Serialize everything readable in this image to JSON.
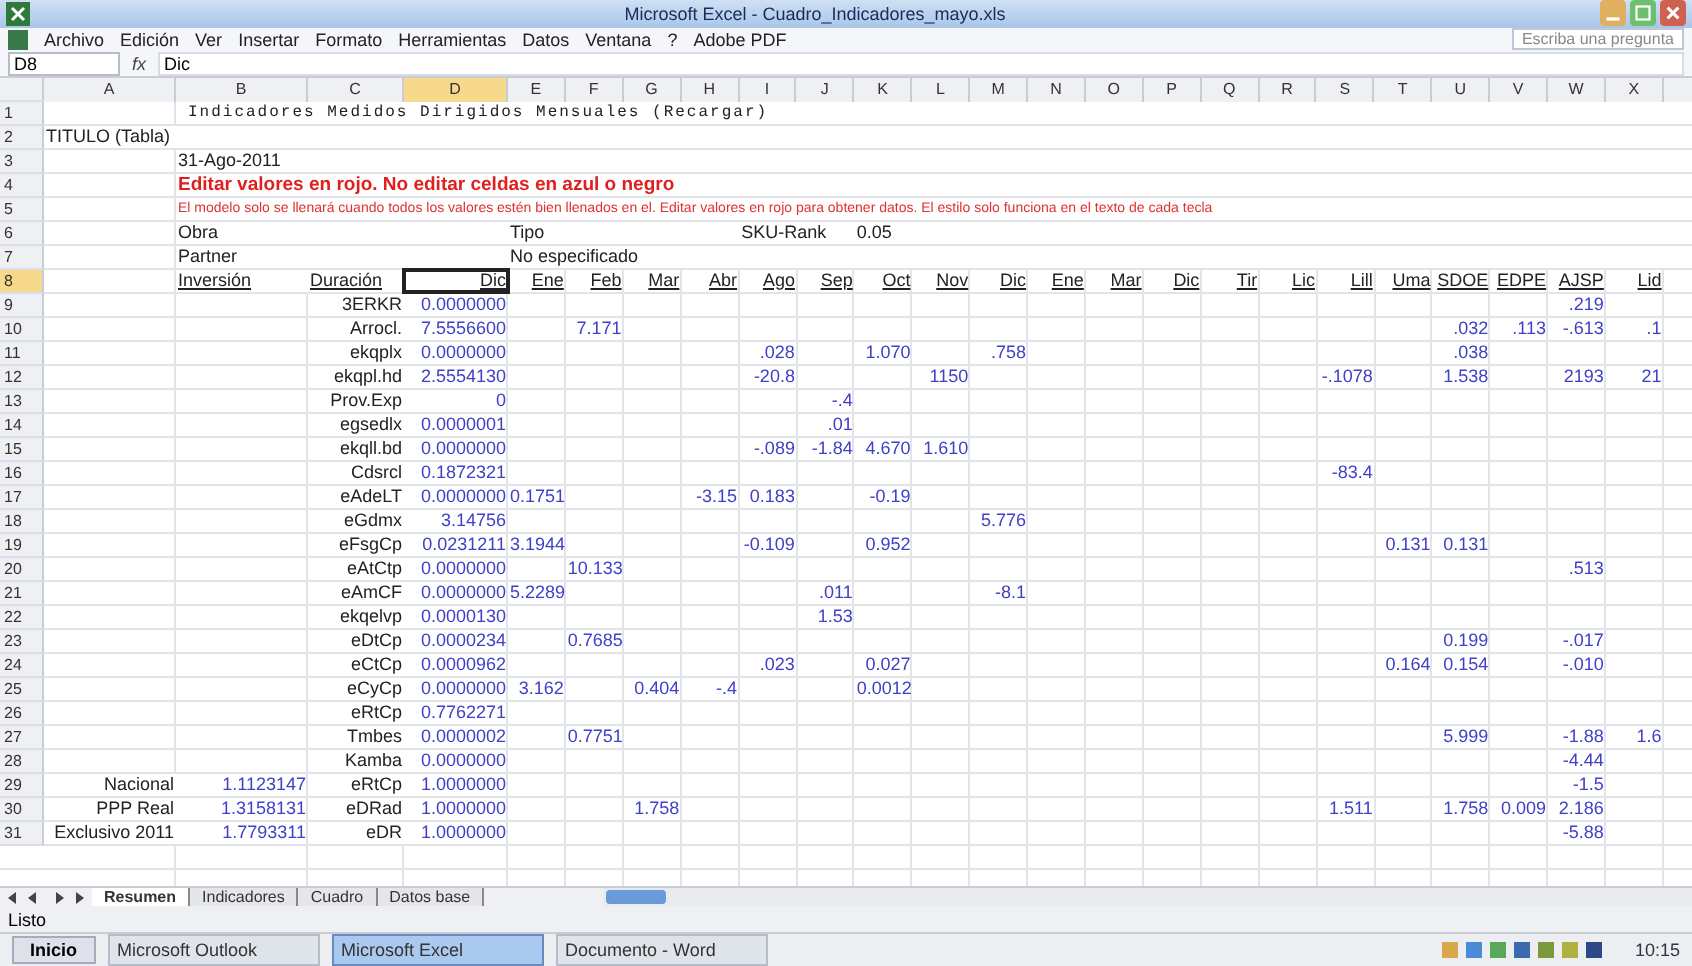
{
  "window": {
    "title": "Microsoft Excel - Cuadro_Indicadores_mayo.xls"
  },
  "menu": [
    "Archivo",
    "Edición",
    "Ver",
    "Insertar",
    "Formato",
    "Herramientas",
    "Datos",
    "Ventana",
    "?",
    "Adobe PDF"
  ],
  "help_box": {
    "placeholder": "Escriba una pregunta"
  },
  "name_box": "D8",
  "formula_label": "fx",
  "formula": "Dic",
  "columns": [
    "A",
    "B",
    "C",
    "D",
    "E",
    "F",
    "G",
    "H",
    "I",
    "J",
    "K",
    "L",
    "M",
    "N",
    "O",
    "P",
    "Q",
    "R",
    "S",
    "T",
    "U",
    "V",
    "W",
    "X"
  ],
  "rows": [
    {
      "num": "1",
      "kind": "title",
      "cells": {
        "B": {
          "kind": "label",
          "text": "Indicadores Medidos Dirigidos Mensuales (Recargar)"
        }
      }
    },
    {
      "num": "2",
      "kind": "plain",
      "cells": {
        "A": {
          "kind": "label",
          "text": "TITULO (Tabla)"
        }
      }
    },
    {
      "num": "3",
      "kind": "plain",
      "cells": {
        "B": {
          "kind": "label",
          "text": "31-Ago-2011"
        }
      }
    },
    {
      "num": "4",
      "kind": "warning",
      "cells": {
        "B": {
          "kind": "label",
          "text": "Editar valores en rojo. No editar celdas en azul o negro"
        }
      }
    },
    {
      "num": "5",
      "kind": "notice",
      "cells": {
        "B": {
          "kind": "label",
          "text": "El modelo solo se llenará cuando todos los valores estén bien llenados en el. Editar valores en rojo para obtener datos. El estilo solo funciona en el texto de cada tecla"
        }
      }
    },
    {
      "num": "6",
      "kind": "plain",
      "cells": {
        "B": {
          "kind": "label",
          "text": "Obra"
        },
        "E": {
          "kind": "label",
          "text": "Tipo"
        },
        "I": {
          "kind": "label",
          "text": "SKU-Rank"
        },
        "K": {
          "kind": "label",
          "text": "0.05"
        }
      }
    },
    {
      "num": "7",
      "kind": "plain",
      "cells": {
        "B": {
          "kind": "label",
          "text": "Partner"
        },
        "E": {
          "kind": "label",
          "text": "No especificado"
        }
      }
    },
    {
      "num": "8",
      "kind": "header",
      "cells": {
        "B": {
          "kind": "label",
          "text": "Inversión"
        },
        "C": {
          "kind": "label",
          "text": "Duración"
        },
        "D": {
          "kind": "head",
          "text": "Dic"
        },
        "E": {
          "kind": "head",
          "text": "Ene"
        },
        "F": {
          "kind": "head",
          "text": "Feb"
        },
        "G": {
          "kind": "head",
          "text": "Mar"
        },
        "H": {
          "kind": "head",
          "text": "Abr"
        },
        "I": {
          "kind": "head",
          "text": "Ago"
        },
        "J": {
          "kind": "head",
          "text": "Sep"
        },
        "K": {
          "kind": "head",
          "text": "Oct"
        },
        "L": {
          "kind": "head",
          "text": "Nov"
        },
        "M": {
          "kind": "head",
          "text": "Dic"
        },
        "N": {
          "kind": "head",
          "text": "Ene"
        },
        "O": {
          "kind": "head",
          "text": "Mar"
        },
        "P": {
          "kind": "head",
          "text": "Dic"
        },
        "Q": {
          "kind": "head",
          "text": "Tir"
        },
        "R": {
          "kind": "head",
          "text": "Lic"
        },
        "S": {
          "kind": "head",
          "text": "Lill"
        },
        "T": {
          "kind": "head",
          "text": "Uma"
        },
        "U": {
          "kind": "head",
          "text": "SDOE"
        },
        "V": {
          "kind": "head",
          "text": "EDPE"
        },
        "W": {
          "kind": "head",
          "text": "AJSP"
        },
        "X": {
          "kind": "head",
          "text": "Lid"
        }
      }
    },
    {
      "num": "9",
      "kind": "data",
      "cells": {
        "C": {
          "kind": "label",
          "text": "3ERKR"
        },
        "D": {
          "kind": "input",
          "text": "0.0000000"
        },
        "W": {
          "kind": "input",
          "text": ".219"
        }
      }
    },
    {
      "num": "10",
      "kind": "data",
      "cells": {
        "C": {
          "kind": "label",
          "text": "Arrocl."
        },
        "D": {
          "kind": "input",
          "text": "7.5556600"
        },
        "F": {
          "kind": "input",
          "text": "7.171"
        },
        "U": {
          "kind": "input",
          "text": ".032"
        },
        "V": {
          "kind": "input",
          "text": ".113"
        },
        "W": {
          "kind": "input",
          "text": "-.613"
        },
        "X": {
          "kind": "input",
          "text": ".1"
        }
      }
    },
    {
      "num": "11",
      "kind": "data",
      "cells": {
        "C": {
          "kind": "label",
          "text": "ekqplx"
        },
        "D": {
          "kind": "input",
          "text": "0.0000000"
        },
        "I": {
          "kind": "input",
          "text": ".028"
        },
        "K": {
          "kind": "input",
          "text": "1.070"
        },
        "M": {
          "kind": "input",
          "text": ".758"
        },
        "U": {
          "kind": "input",
          "text": ".038"
        }
      }
    },
    {
      "num": "12",
      "kind": "data",
      "cells": {
        "C": {
          "kind": "label",
          "text": "ekqpl.hd"
        },
        "D": {
          "kind": "input",
          "text": "2.5554130"
        },
        "I": {
          "kind": "input",
          "text": "-20.8"
        },
        "L": {
          "kind": "input",
          "text": "1150"
        },
        "S": {
          "kind": "input",
          "text": "-.1078"
        },
        "U": {
          "kind": "input",
          "text": "1.538"
        },
        "W": {
          "kind": "input",
          "text": "2193"
        },
        "X": {
          "kind": "input",
          "text": "21"
        }
      }
    },
    {
      "num": "13",
      "kind": "data",
      "cells": {
        "C": {
          "kind": "label",
          "text": "Prov.Exp"
        },
        "D": {
          "kind": "input",
          "text": "0"
        },
        "J": {
          "kind": "input",
          "text": "-.4"
        }
      }
    },
    {
      "num": "14",
      "kind": "data",
      "cells": {
        "C": {
          "kind": "label",
          "text": "egsedlx"
        },
        "D": {
          "kind": "input",
          "text": "0.0000001"
        },
        "J": {
          "kind": "input",
          "text": ".01"
        }
      }
    },
    {
      "num": "15",
      "kind": "data",
      "cells": {
        "C": {
          "kind": "label",
          "text": "ekqll.bd"
        },
        "D": {
          "kind": "input",
          "text": "0.0000000"
        },
        "I": {
          "kind": "input",
          "text": "-.089"
        },
        "J": {
          "kind": "input",
          "text": "-1.84"
        },
        "K": {
          "kind": "input",
          "text": "4.670"
        },
        "L": {
          "kind": "input",
          "text": "1.610"
        }
      }
    },
    {
      "num": "16",
      "kind": "data",
      "cells": {
        "C": {
          "kind": "label",
          "text": "Cdsrcl"
        },
        "D": {
          "kind": "input",
          "text": "0.1872321"
        },
        "S": {
          "kind": "input",
          "text": "-83.4"
        }
      }
    },
    {
      "num": "17",
      "kind": "data",
      "cells": {
        "C": {
          "kind": "label",
          "text": "eAdeLT"
        },
        "D": {
          "kind": "input",
          "text": "0.0000000"
        },
        "E": {
          "kind": "input",
          "text": "0.1751"
        },
        "H": {
          "kind": "input",
          "text": "-3.15"
        },
        "I": {
          "kind": "input",
          "text": "0.183"
        },
        "K": {
          "kind": "input",
          "text": "-0.19"
        }
      }
    },
    {
      "num": "18",
      "kind": "data",
      "cells": {
        "C": {
          "kind": "label",
          "text": "eGdmx"
        },
        "D": {
          "kind": "input",
          "text": "3.14756"
        },
        "M": {
          "kind": "input",
          "text": "5.776"
        }
      }
    },
    {
      "num": "19",
      "kind": "data",
      "cells": {
        "C": {
          "kind": "label",
          "text": "eFsgCp"
        },
        "D": {
          "kind": "input",
          "text": "0.0231211"
        },
        "E": {
          "kind": "input",
          "text": "3.1944"
        },
        "I": {
          "kind": "input",
          "text": "-0.109"
        },
        "K": {
          "kind": "input",
          "text": "0.952"
        },
        "T": {
          "kind": "input",
          "text": "0.131"
        },
        "U": {
          "kind": "input",
          "text": "0.131"
        }
      }
    },
    {
      "num": "20",
      "kind": "data",
      "cells": {
        "C": {
          "kind": "label",
          "text": "eAtCtp"
        },
        "D": {
          "kind": "input",
          "text": "0.0000000"
        },
        "F": {
          "kind": "input",
          "text": "10.133"
        },
        "W": {
          "kind": "input",
          "text": ".513"
        }
      }
    },
    {
      "num": "21",
      "kind": "data",
      "cells": {
        "C": {
          "kind": "label",
          "text": "eAmCF"
        },
        "D": {
          "kind": "input",
          "text": "0.0000000"
        },
        "E": {
          "kind": "input",
          "text": "5.2289"
        },
        "J": {
          "kind": "input",
          "text": ".011"
        },
        "M": {
          "kind": "input",
          "text": "-8.1"
        }
      }
    },
    {
      "num": "22",
      "kind": "data",
      "cells": {
        "C": {
          "kind": "label",
          "text": "ekqelvp"
        },
        "D": {
          "kind": "input",
          "text": "0.0000130"
        },
        "J": {
          "kind": "input",
          "text": "1.53"
        }
      }
    },
    {
      "num": "23",
      "kind": "data",
      "cells": {
        "C": {
          "kind": "label",
          "text": "eDtCp"
        },
        "D": {
          "kind": "input",
          "text": "0.0000234"
        },
        "F": {
          "kind": "input",
          "text": "0.7685"
        },
        "U": {
          "kind": "input",
          "text": "0.199"
        },
        "W": {
          "kind": "input",
          "text": "-.017"
        }
      }
    },
    {
      "num": "24",
      "kind": "data",
      "cells": {
        "C": {
          "kind": "label",
          "text": "eCtCp"
        },
        "D": {
          "kind": "input",
          "text": "0.0000962"
        },
        "I": {
          "kind": "input",
          "text": ".023"
        },
        "K": {
          "kind": "input",
          "text": "0.027"
        },
        "T": {
          "kind": "input",
          "text": "0.164"
        },
        "U": {
          "kind": "input",
          "text": "0.154"
        },
        "W": {
          "kind": "input",
          "text": "-.010"
        }
      }
    },
    {
      "num": "25",
      "kind": "data",
      "cells": {
        "C": {
          "kind": "label",
          "text": "eCyCp"
        },
        "D": {
          "kind": "input",
          "text": "0.0000000"
        },
        "E": {
          "kind": "input",
          "text": "3.162"
        },
        "G": {
          "kind": "input",
          "text": "0.404"
        },
        "H": {
          "kind": "input",
          "text": "-.4"
        },
        "K": {
          "kind": "input",
          "text": "0.0012"
        }
      }
    },
    {
      "num": "26",
      "kind": "data",
      "cells": {
        "C": {
          "kind": "label",
          "text": "eRtCp"
        },
        "D": {
          "kind": "input",
          "text": "0.7762271"
        }
      }
    },
    {
      "num": "27",
      "kind": "data",
      "cells": {
        "C": {
          "kind": "label",
          "text": "Tmbes"
        },
        "D": {
          "kind": "input",
          "text": "0.0000002"
        },
        "F": {
          "kind": "input",
          "text": "0.7751"
        },
        "U": {
          "kind": "input",
          "text": "5.999"
        },
        "W": {
          "kind": "input",
          "text": "-1.88"
        },
        "X": {
          "kind": "input",
          "text": "1.6"
        }
      }
    },
    {
      "num": "28",
      "kind": "data",
      "cells": {
        "C": {
          "kind": "label",
          "text": "Kamba"
        },
        "D": {
          "kind": "input",
          "text": "0.0000000"
        },
        "W": {
          "kind": "input",
          "text": "-4.44"
        }
      }
    },
    {
      "num": "29",
      "kind": "data",
      "cells": {
        "A": {
          "kind": "label",
          "text": "Nacional"
        },
        "B": {
          "kind": "input",
          "text": "1.1123147"
        },
        "C": {
          "kind": "label",
          "text": "eRtCp"
        },
        "D": {
          "kind": "input",
          "text": "1.0000000"
        },
        "W": {
          "kind": "input",
          "text": "-1.5"
        }
      }
    },
    {
      "num": "30",
      "kind": "data",
      "cells": {
        "A": {
          "kind": "label",
          "text": "PPP Real"
        },
        "B": {
          "kind": "input",
          "text": "1.3158131"
        },
        "C": {
          "kind": "label",
          "text": "eDRad"
        },
        "D": {
          "kind": "input",
          "text": "1.0000000"
        },
        "G": {
          "kind": "input",
          "text": "1.758"
        },
        "S": {
          "kind": "input",
          "text": "1.511"
        },
        "U": {
          "kind": "input",
          "text": "1.758"
        },
        "V": {
          "kind": "input",
          "text": "0.009"
        },
        "W": {
          "kind": "input",
          "text": "2.186"
        }
      }
    },
    {
      "num": "31",
      "kind": "data",
      "cells": {
        "A": {
          "kind": "label",
          "text": "Exclusivo 2011"
        },
        "B": {
          "kind": "input",
          "text": "1.7793311"
        },
        "C": {
          "kind": "label",
          "text": "eDR"
        },
        "D": {
          "kind": "input",
          "text": "1.0000000"
        },
        "W": {
          "kind": "input",
          "text": "-5.88"
        }
      }
    }
  ],
  "sheet_tabs": [
    {
      "label": "Resumen",
      "selected": true
    },
    {
      "label": "Indicadores",
      "selected": false
    },
    {
      "label": "Cuadro",
      "selected": false
    },
    {
      "label": "Datos base",
      "selected": false
    }
  ],
  "status": "Listo",
  "taskbar": {
    "start": "Inicio",
    "items": [
      {
        "label": "Microsoft Outlook",
        "selected": false
      },
      {
        "label": "Microsoft Excel",
        "selected": true
      },
      {
        "label": "Documento - Word",
        "selected": false
      }
    ],
    "clock": "10:15"
  }
}
